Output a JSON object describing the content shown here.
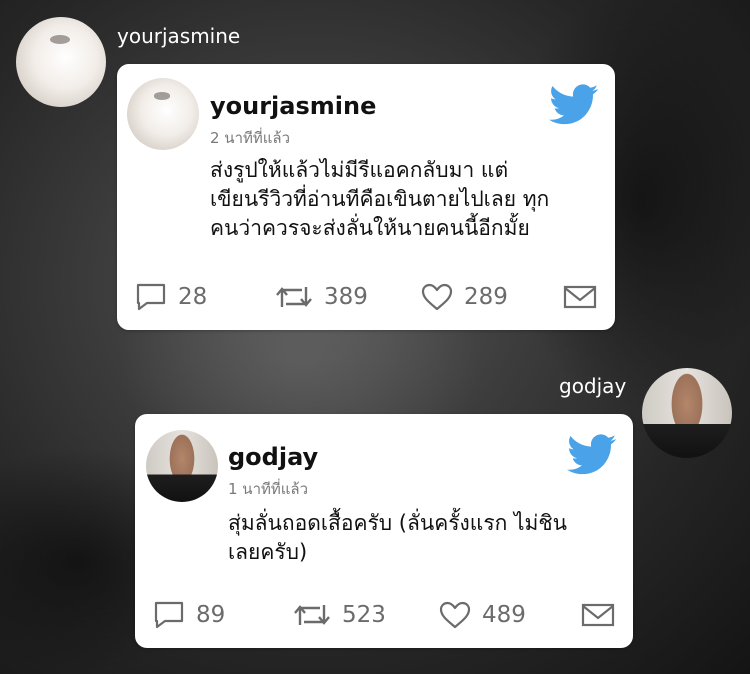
{
  "posts": [
    {
      "outer_username": "yourjasmine",
      "name": "yourjasmine",
      "time": "2 นาทีที่แล้ว",
      "text": "ส่งรูปให้แล้วไม่มีรีแอคกลับมา แต่\nเขียนรีวิวที่อ่านทีคือเขินตายไปเลย ทุก\nคนว่าควรจะส่งลั่นให้นายคนนี้อีกมั้ย",
      "replies": "28",
      "retweets": "389",
      "likes": "289"
    },
    {
      "outer_username": "godjay",
      "name": "godjay",
      "time": "1 นาทีที่แล้ว",
      "text": "สุ่มลั่นถอดเสื้อครับ (ลั่นครั้งแรก ไม่ชิน\nเลยครับ)",
      "replies": "89",
      "retweets": "523",
      "likes": "489"
    }
  ],
  "colors": {
    "twitter_blue": "#1da1f2",
    "icon_gray": "#6b6b6b"
  },
  "icons": [
    "twitter-bird-icon",
    "reply-icon",
    "retweet-icon",
    "like-icon",
    "mail-icon"
  ]
}
